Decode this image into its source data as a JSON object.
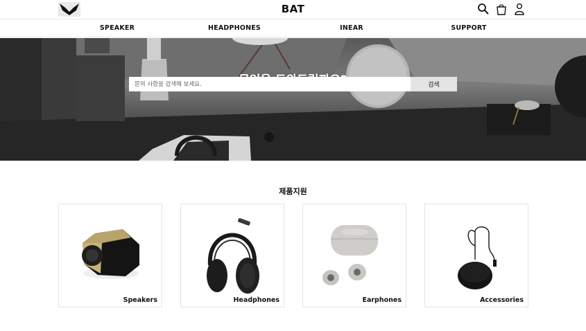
{
  "header": {
    "brand": "BAT",
    "icons": [
      "bat-logo-icon",
      "search-icon",
      "shopping-bag-icon",
      "user-icon"
    ]
  },
  "nav": {
    "items": [
      {
        "label": "SPEAKER"
      },
      {
        "label": "HEADPHONES"
      },
      {
        "label": "INEAR"
      },
      {
        "label": "SUPPORT"
      }
    ]
  },
  "hero": {
    "title": "무엇을 도와드릴까요?",
    "search_placeholder": "문의 사항을 검색해 보세요.",
    "search_button": "검색"
  },
  "support": {
    "title": "제품지원",
    "cards": [
      {
        "label": "Speakers",
        "icon": "speaker-icon"
      },
      {
        "label": "Headphones",
        "icon": "headphones-icon"
      },
      {
        "label": "Earphones",
        "icon": "earphones-icon"
      },
      {
        "label": "Accessories",
        "icon": "charging-pad-icon"
      }
    ]
  },
  "colors": {
    "text": "#111111",
    "divider": "#e6e6e6",
    "button_bg": "#e4e4e4",
    "gold_accent": "#c7b27a"
  }
}
